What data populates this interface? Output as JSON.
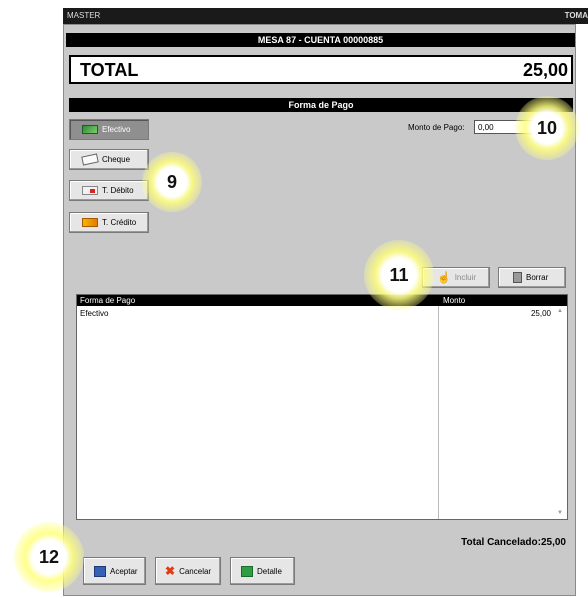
{
  "titlebar": {
    "left": "MASTER",
    "right": "TOMA"
  },
  "header": {
    "mesa": "MESA 87 - CUENTA 00000885",
    "total_label": "TOTAL",
    "total_value": "25,00"
  },
  "forma_pago": {
    "title": "Forma de Pago",
    "methods": [
      {
        "label": "Efectivo",
        "icon": "cash-icon",
        "active": true
      },
      {
        "label": "Cheque",
        "icon": "cheque-icon",
        "active": false
      },
      {
        "label": "T. Débito",
        "icon": "debit-card-icon",
        "active": false
      },
      {
        "label": "T. Crédito",
        "icon": "credit-card-icon",
        "active": false
      }
    ],
    "monto_label": "Monto de Pago:",
    "monto_value": "0,00"
  },
  "actions": {
    "incluir": "Incluir",
    "borrar": "Borrar"
  },
  "grid": {
    "columns": [
      "Forma de Pago",
      "Monto"
    ],
    "rows": [
      {
        "forma": "Efectivo",
        "monto": "25,00"
      }
    ]
  },
  "total_cancelado": "Total Cancelado:25,00",
  "footer": {
    "aceptar": "Aceptar",
    "cancelar": "Cancelar",
    "detalle": "Detalle"
  },
  "annotations": [
    "9",
    "10",
    "11",
    "12"
  ],
  "colors": {
    "header_bg": "#000000",
    "window_bg": "#c9c9c9",
    "highlight": "#ffff78"
  }
}
